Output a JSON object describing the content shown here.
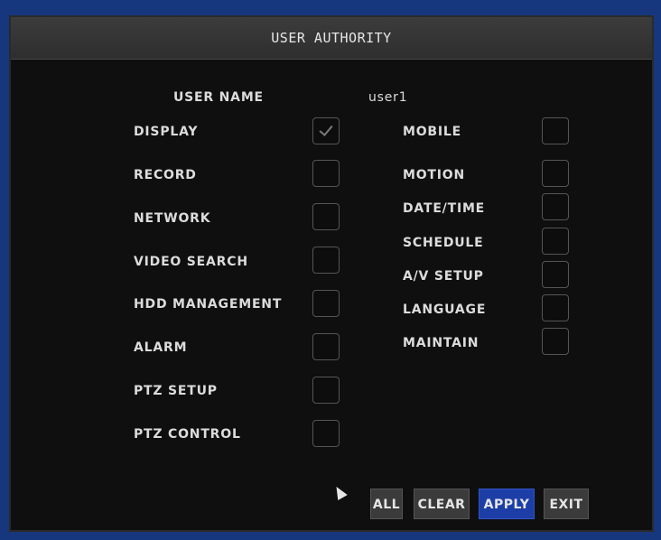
{
  "window": {
    "title": "USER AUTHORITY"
  },
  "user": {
    "label": "USER NAME",
    "value": "user1"
  },
  "left_permissions": [
    {
      "label": "DISPLAY",
      "checked": true
    },
    {
      "label": "RECORD",
      "checked": false
    },
    {
      "label": "NETWORK",
      "checked": false
    },
    {
      "label": "VIDEO SEARCH",
      "checked": false
    },
    {
      "label": "HDD MANAGEMENT",
      "checked": false
    },
    {
      "label": "ALARM",
      "checked": false
    },
    {
      "label": "PTZ SETUP",
      "checked": false
    },
    {
      "label": "PTZ CONTROL",
      "checked": false
    }
  ],
  "right_permissions": [
    {
      "label": "MOBILE",
      "checked": false
    },
    {
      "label": "MOTION",
      "checked": false
    },
    {
      "label": "DATE/TIME",
      "checked": false
    },
    {
      "label": "SCHEDULE",
      "checked": false
    },
    {
      "label": "A/V SETUP",
      "checked": false
    },
    {
      "label": "LANGUAGE",
      "checked": false
    },
    {
      "label": "MAINTAIN",
      "checked": false
    }
  ],
  "buttons": {
    "all": "ALL",
    "clear": "CLEAR",
    "apply": "APPLY",
    "exit": "EXIT"
  },
  "colors": {
    "accent": "#1d3ea6",
    "frame": "#16377d",
    "background": "#0f0f0f"
  }
}
